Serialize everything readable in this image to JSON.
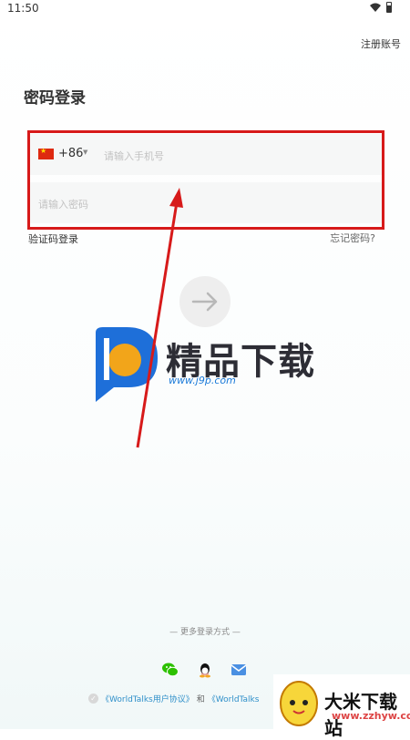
{
  "status_bar": {
    "time": "11:50"
  },
  "header": {
    "register_link": "注册账号",
    "title": "密码登录"
  },
  "form": {
    "country_code": "+86",
    "phone_placeholder": "请输入手机号",
    "password_placeholder": "请输入密码",
    "sms_login_link": "验证码登录",
    "forgot_password_link": "忘记密码?"
  },
  "more_login": {
    "label": "— 更多登录方式 —",
    "options": [
      "wechat-icon",
      "qq-icon",
      "mail-icon"
    ]
  },
  "agreement": {
    "link1": "《WorldTalks用户协议》",
    "and": "和",
    "link2": "《WorldTalks"
  },
  "watermarks": {
    "primary_title": "精品下载",
    "primary_url": "www.j9p.com",
    "secondary_title": "大米下载站",
    "secondary_url": "www.zzhyw.com"
  },
  "colors": {
    "annotation_red": "#d71a1a",
    "link_blue": "#2f8fc9",
    "wechat_green": "#2dc100",
    "mail_blue": "#4a90e2"
  }
}
